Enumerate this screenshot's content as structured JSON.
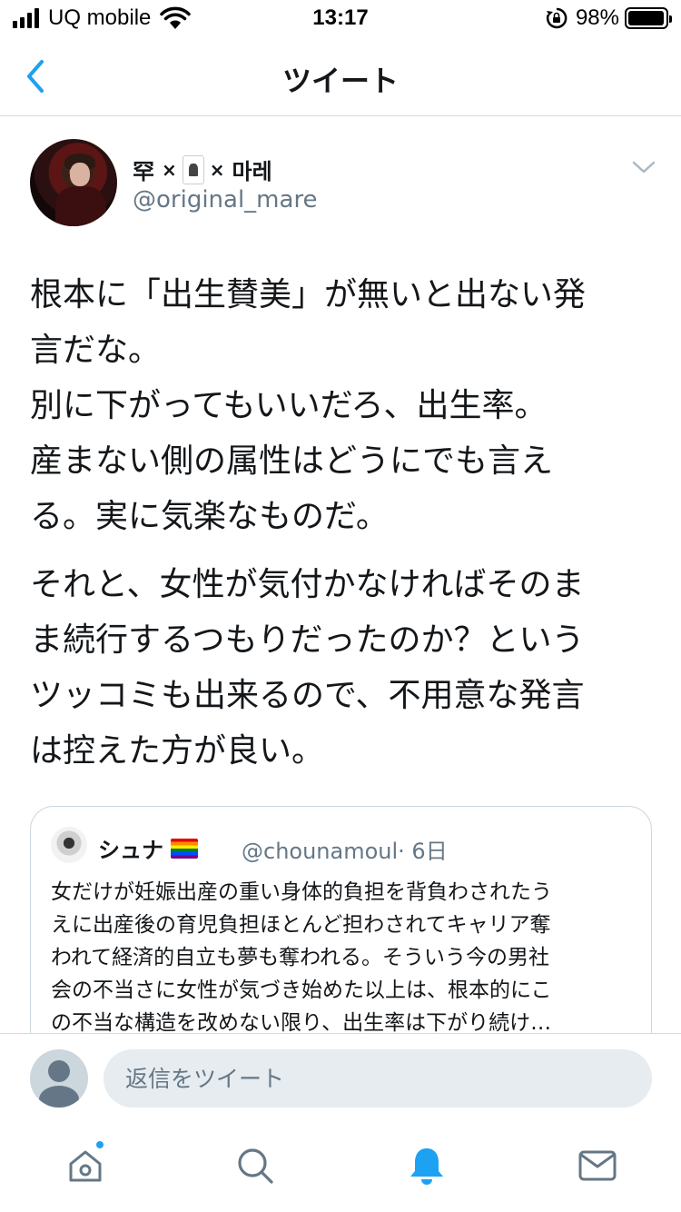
{
  "status_bar": {
    "carrier": "UQ mobile",
    "time": "13:17",
    "battery_percent": "98%",
    "battery_level": 0.98,
    "icons": [
      "signal-icon",
      "wifi-icon",
      "rotation-lock-icon",
      "battery-icon"
    ]
  },
  "nav": {
    "title": "ツイート",
    "back_icon": "chevron-left-icon"
  },
  "tweet": {
    "author": {
      "name_part1": "罕",
      "name_sep1": "×",
      "name_sep2": "×",
      "name_part2": "마레",
      "handle": "@original_mare"
    },
    "paragraph1": [
      "根本に「出生賛美」が無いと出ない発",
      "言だな。",
      "別に下がってもいいだろ、出生率。",
      "産まない側の属性はどうにでも言え",
      "る。実に気楽なものだ。"
    ],
    "paragraph2": [
      "それと、女性が気付かなければそのま",
      "ま続行するつもりだったのか？という",
      "ツッコミも出来るので、不用意な発言",
      "は控えた方が良い。"
    ]
  },
  "quote": {
    "name": "シュナ",
    "handle": "@chounamoul",
    "time": "· 6日",
    "lines": [
      "女だけが妊娠出産の重い身体的負担を背負わされたう",
      "えに出産後の育児負担ほとんど担わされてキャリア奪",
      "われて経済的自立も夢も奪われる。そういう今の男社",
      "会の不当さに女性が気づき始めた以上は、根本的にこ",
      "の不当な構造を改めない限り、出生率は下がり続け…"
    ]
  },
  "reply": {
    "placeholder": "返信をツイート"
  },
  "tab_bar": {
    "tabs": [
      "home-icon",
      "search-icon",
      "notifications-icon",
      "messages-icon"
    ],
    "active": "notifications",
    "accent": "#1da1f2",
    "inactive": "#657786"
  }
}
